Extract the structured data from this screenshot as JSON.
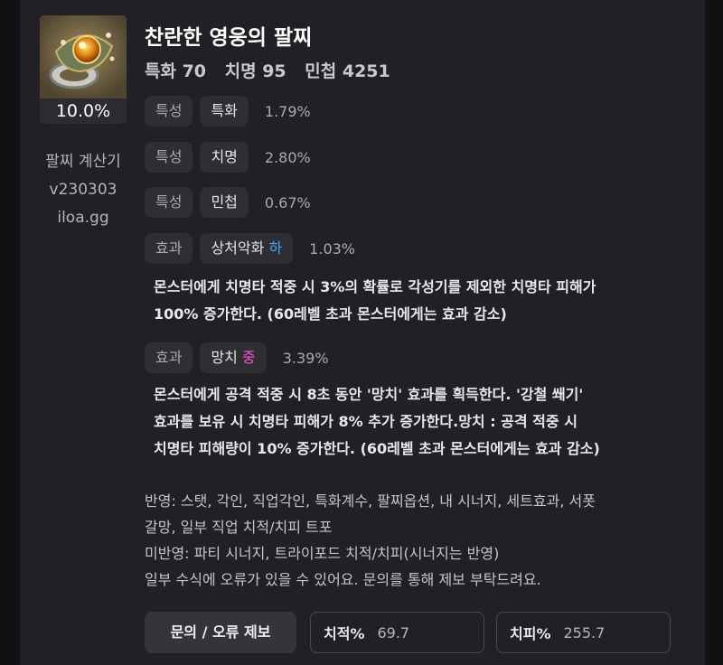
{
  "item": {
    "percent": "10.0%",
    "name": "찬란한 영웅의 팔찌",
    "stats": [
      "특화 70",
      "치명 95",
      "민첩 4251"
    ]
  },
  "calculator": {
    "name": "팔찌 계산기",
    "version": "v230303",
    "site": "iloa.gg"
  },
  "traits": [
    {
      "type": "특성",
      "name": "특화",
      "value": "1.79%"
    },
    {
      "type": "특성",
      "name": "치명",
      "value": "2.80%"
    },
    {
      "type": "특성",
      "name": "민첩",
      "value": "0.67%"
    }
  ],
  "effects": [
    {
      "type": "효과",
      "name": "상처악화",
      "grade": "하",
      "value": "1.03%",
      "desc": [
        "몬스터에게 치명타 적중 시 3%의 확률로 각성기를 제외한 치명타 피해가",
        "100% 증가한다. (60레벨 초과 몬스터에게는 효과 감소)"
      ]
    },
    {
      "type": "효과",
      "name": "망치",
      "grade": "중",
      "value": "3.39%",
      "desc": [
        "몬스터에게 공격 적중 시 8초 동안 '망치' 효과를 획득한다. '강철 쐐기'",
        "효과를 보유 시 치명타 피해가 8% 추가 증가한다.망치 : 공격 적중 시",
        "치명타 피해량이 10% 증가한다. (60레벨 초과 몬스터에게는 효과 감소)"
      ]
    }
  ],
  "notes": [
    "반영: 스탯, 각인, 직업각인, 특화계수, 팔찌옵션, 내 시너지, 세트효과, 서폿",
    "갈망, 일부 직업 치적/치피 트포",
    "미반영: 파티 시너지, 트라이포드 치적/치피(시너지는 반영)",
    "일부 수식에 오류가 있을 수 있어요. 문의를 통해 제보 부탁드려요."
  ],
  "footer": {
    "report_label": "문의 / 오류 제보",
    "crit_rate_label": "치적%",
    "crit_rate_value": "69.7",
    "crit_dmg_label": "치피%",
    "crit_dmg_value": "255.7"
  },
  "colors": {
    "grade_low": "#3fa9f5",
    "grade_mid": "#ff4fd8"
  }
}
